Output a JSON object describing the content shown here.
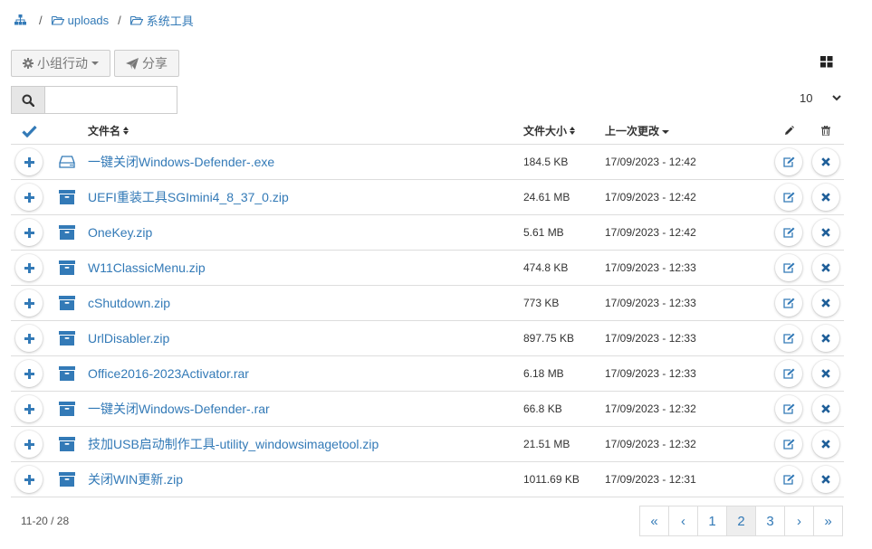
{
  "breadcrumb": {
    "home_icon": "sitemap-icon",
    "separator": "/",
    "items": [
      {
        "label": "uploads",
        "icon": "folder-open-icon"
      },
      {
        "label": "系统工具",
        "icon": "folder-open-icon"
      }
    ]
  },
  "toolbar": {
    "group_action_label": "小组行动",
    "share_label": "分享"
  },
  "search": {
    "placeholder": "",
    "value": ""
  },
  "per_page": "10",
  "table": {
    "headers": {
      "name": "文件名",
      "size": "文件大小",
      "modified": "上一次更改"
    },
    "rows": [
      {
        "name": "一键关闭Windows-Defender-.exe",
        "size": "184.5 KB",
        "date": "17/09/2023 - 12:42",
        "icon": "hdd-icon"
      },
      {
        "name": "UEFI重装工具SGImini4_8_37_0.zip",
        "size": "24.61 MB",
        "date": "17/09/2023 - 12:42",
        "icon": "archive-icon"
      },
      {
        "name": "OneKey.zip",
        "size": "5.61 MB",
        "date": "17/09/2023 - 12:42",
        "icon": "archive-icon"
      },
      {
        "name": "W11ClassicMenu.zip",
        "size": "474.8 KB",
        "date": "17/09/2023 - 12:33",
        "icon": "archive-icon"
      },
      {
        "name": "cShutdown.zip",
        "size": "773 KB",
        "date": "17/09/2023 - 12:33",
        "icon": "archive-icon"
      },
      {
        "name": "UrlDisabler.zip",
        "size": "897.75 KB",
        "date": "17/09/2023 - 12:33",
        "icon": "archive-icon"
      },
      {
        "name": "Office2016-2023Activator.rar",
        "size": "6.18 MB",
        "date": "17/09/2023 - 12:33",
        "icon": "archive-icon"
      },
      {
        "name": "一键关闭Windows-Defender-.rar",
        "size": "66.8 KB",
        "date": "17/09/2023 - 12:32",
        "icon": "archive-icon"
      },
      {
        "name": "技加USB启动制作工具-utility_windowsimagetool.zip",
        "size": "21.51 MB",
        "date": "17/09/2023 - 12:32",
        "icon": "archive-icon"
      },
      {
        "name": "关闭WIN更新.zip",
        "size": "1011.69 KB",
        "date": "17/09/2023 - 12:31",
        "icon": "archive-icon"
      }
    ]
  },
  "footer": {
    "count": "11-20 / 28",
    "pages": [
      {
        "label": "«",
        "name": "first"
      },
      {
        "label": "‹",
        "name": "prev"
      },
      {
        "label": "1",
        "name": "1"
      },
      {
        "label": "2",
        "name": "2",
        "active": true
      },
      {
        "label": "3",
        "name": "3"
      },
      {
        "label": "›",
        "name": "next"
      },
      {
        "label": "»",
        "name": "last"
      }
    ]
  },
  "colors": {
    "link": "#337ab7",
    "delete": "#1f5f99",
    "border": "#dddddd"
  }
}
